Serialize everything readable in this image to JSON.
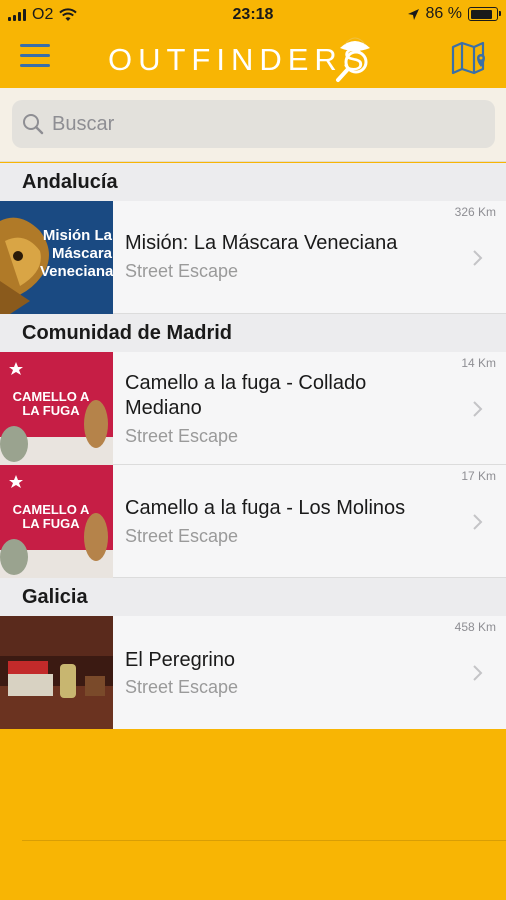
{
  "status_bar": {
    "carrier": "O2",
    "time": "23:18",
    "battery_percent": "86 %",
    "battery_level": 0.86
  },
  "nav": {
    "menu_icon": "hamburger-menu-icon",
    "logo_text": "OUTFINDERS",
    "map_icon": "map-icon"
  },
  "search": {
    "placeholder": "Buscar",
    "value": ""
  },
  "colors": {
    "accent": "#F8B504",
    "icon_blue": "#3A6FA8",
    "section_bg": "#ECECEE",
    "row_bg": "#F6F6F7"
  },
  "sections": [
    {
      "header": "Andalucía",
      "items": [
        {
          "title": "Misión: La Máscara Veneciana",
          "subtitle": "Street Escape",
          "distance": "326 Km",
          "thumb_text": "Misión La Máscara Veneciana"
        }
      ]
    },
    {
      "header": "Comunidad de Madrid",
      "items": [
        {
          "title": "Camello a la fuga - Collado Mediano",
          "subtitle": "Street Escape",
          "distance": "14 Km",
          "thumb_text": "CAMELLO A LA FUGA"
        },
        {
          "title": "Camello a la fuga - Los Molinos",
          "subtitle": "Street Escape",
          "distance": "17 Km",
          "thumb_text": "CAMELLO A LA FUGA"
        }
      ]
    },
    {
      "header": "Galicia",
      "items": [
        {
          "title": "El Peregrino",
          "subtitle": "Street Escape",
          "distance": "458 Km"
        }
      ]
    }
  ]
}
